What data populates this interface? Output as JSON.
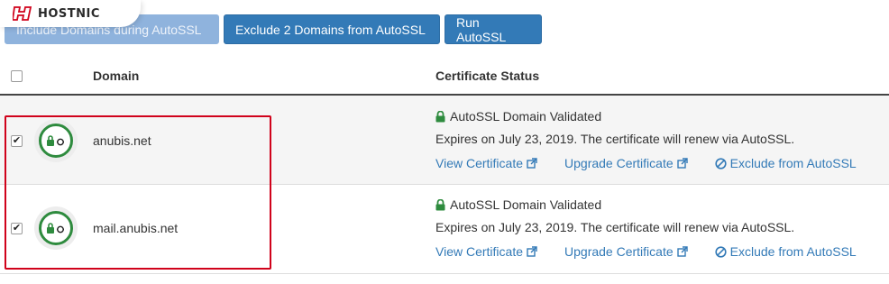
{
  "brand": {
    "name": "HOSTNIC",
    "accent": "#d0021b"
  },
  "toolbar": {
    "include_label": "Include Domains during AutoSSL",
    "exclude_label": "Exclude 2 Domains from AutoSSL",
    "run_label": "Run AutoSSL"
  },
  "table": {
    "headers": {
      "domain": "Domain",
      "status": "Certificate Status"
    },
    "rows": [
      {
        "checked": true,
        "domain": "anubis.net",
        "status": "AutoSSL Domain Validated",
        "expires": "Expires on July 23, 2019. The certificate will renew via AutoSSL.",
        "view_label": "View Certificate",
        "upgrade_label": "Upgrade Certificate",
        "exclude_label": "Exclude from AutoSSL"
      },
      {
        "checked": true,
        "domain": "mail.anubis.net",
        "status": "AutoSSL Domain Validated",
        "expires": "Expires on July 23, 2019. The certificate will renew via AutoSSL.",
        "view_label": "View Certificate",
        "upgrade_label": "Upgrade Certificate",
        "exclude_label": "Exclude from AutoSSL"
      }
    ]
  },
  "colors": {
    "primary": "#337ab7",
    "success": "#2e8b3e",
    "highlight": "#d0021b"
  }
}
